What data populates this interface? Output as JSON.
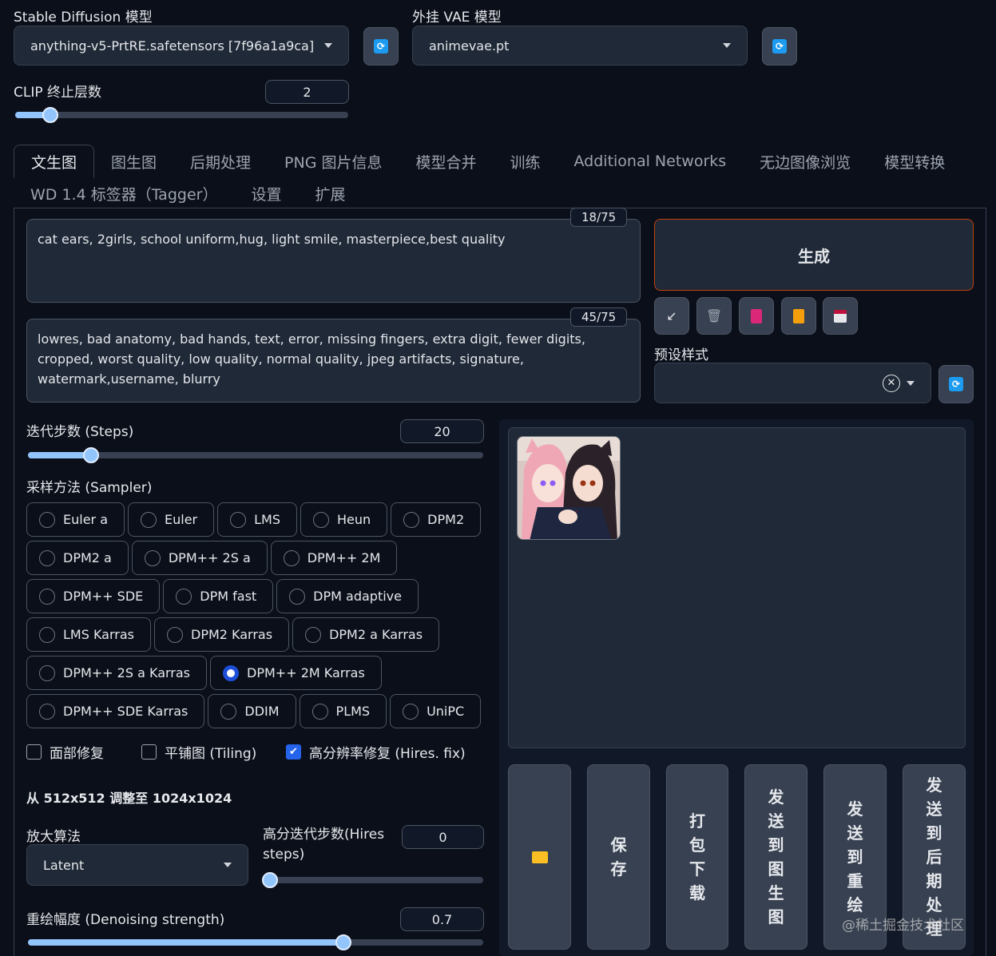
{
  "top": {
    "model_label": "Stable Diffusion 模型",
    "model_value": "anything-v5-PrtRE.safetensors [7f96a1a9ca]",
    "vae_label": "外挂 VAE 模型",
    "vae_value": "animevae.pt",
    "clip_label": "CLIP 终止层数",
    "clip_value": "2",
    "clip_slider_fraction": 0.08,
    "refresh_icon": "refresh-icon"
  },
  "tabs": {
    "row1": [
      "文生图",
      "图生图",
      "后期处理",
      "PNG 图片信息",
      "模型合并",
      "训练",
      "Additional Networks",
      "无边图像浏览",
      "模型转换"
    ],
    "row2": [
      "WD 1.4 标签器（Tagger）",
      "设置",
      "扩展"
    ],
    "active": "文生图"
  },
  "prompt": {
    "text": "cat ears, 2girls, school uniform,hug, light smile, masterpiece,best quality",
    "counter": "18/75"
  },
  "negative": {
    "text": "lowres, bad anatomy, bad hands, text, error, missing fingers, extra digit, fewer digits, cropped, worst quality, low quality, normal quality, jpeg artifacts, signature, watermark,username, blurry",
    "counter": "45/75"
  },
  "generate": {
    "label": "生成",
    "tools": [
      "arrow-icon",
      "trash-icon",
      "card-icon",
      "clipboard-icon",
      "save-icon"
    ],
    "styles_label": "预设样式"
  },
  "steps": {
    "label": "迭代步数 (Steps)",
    "value": "20",
    "slider_fraction": 0.14
  },
  "sampler": {
    "label": "采样方法 (Sampler)",
    "options": [
      "Euler a",
      "Euler",
      "LMS",
      "Heun",
      "DPM2",
      "DPM2 a",
      "DPM++ 2S a",
      "DPM++ 2M",
      "DPM++ SDE",
      "DPM fast",
      "DPM adaptive",
      "LMS Karras",
      "DPM2 Karras",
      "DPM2 a Karras",
      "DPM++ 2S a Karras",
      "DPM++ 2M Karras",
      "DPM++ SDE Karras",
      "DDIM",
      "PLMS",
      "UniPC"
    ],
    "selected": "DPM++ 2M Karras"
  },
  "checks": [
    {
      "label": "面部修复",
      "checked": false
    },
    {
      "label": "平铺图 (Tiling)",
      "checked": false
    },
    {
      "label": "高分辨率修复 (Hires. fix)",
      "checked": true
    }
  ],
  "hires": {
    "resize_text": "从 512x512 调整至 1024x1024",
    "upscaler_label": "放大算法",
    "upscaler_value": "Latent",
    "steps_label": "高分迭代步数(Hires steps)",
    "steps_value": "0",
    "steps_slider_fraction": 0.0,
    "denoise_label": "重绘幅度 (Denoising strength)",
    "denoise_value": "0.7",
    "denoise_slider_fraction": 0.7
  },
  "actions": [
    "folder-icon",
    "保存",
    "打包下载",
    "发送到图生图",
    "发送到重绘",
    "发送到后期处理"
  ],
  "watermark": "@稀土掘金技术社区",
  "colors": {
    "bg": "#0b0f19",
    "accent": "#93c5fd",
    "generate_border": "#c2410c",
    "selected_radio": "#1d4ed8"
  }
}
